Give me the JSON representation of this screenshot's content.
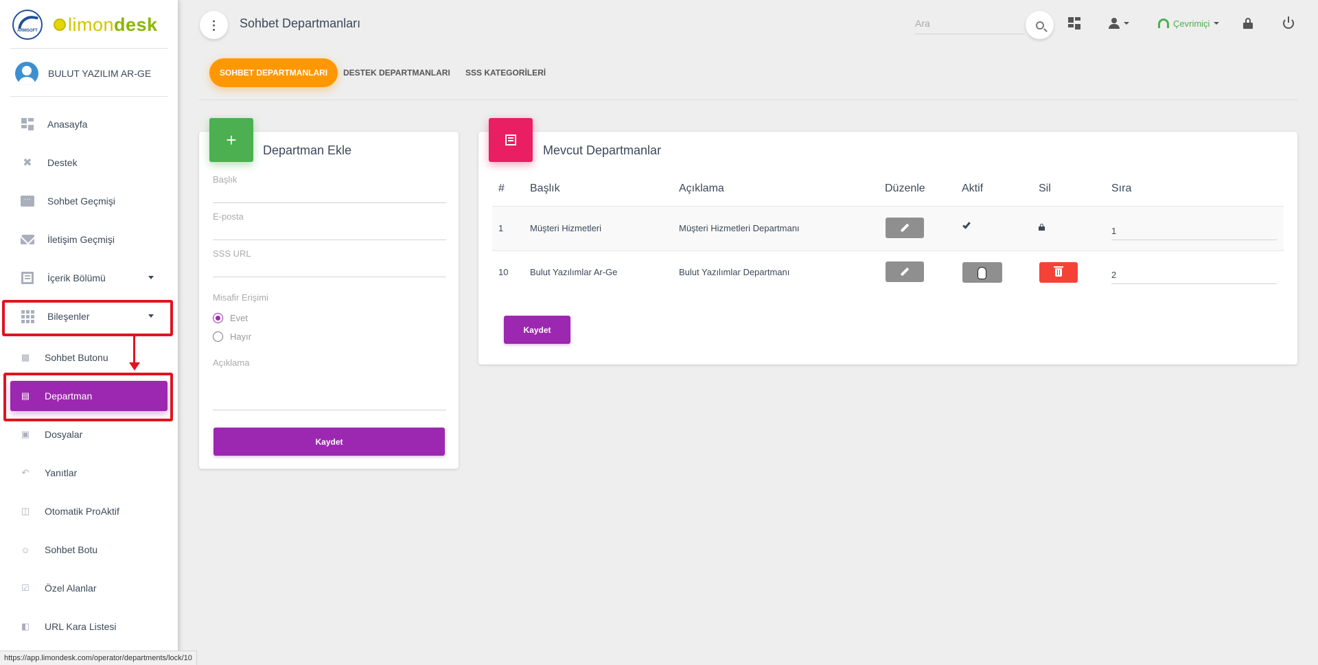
{
  "app": {
    "logo_primary": "limon",
    "logo_secondary": "desk",
    "emblem_text": "ARMSOFT"
  },
  "sidebar": {
    "user_name": "BULUT YAZILIM AR-GE",
    "items": [
      {
        "label": "Anasayfa",
        "icon": "dashboard-icon"
      },
      {
        "label": "Destek",
        "icon": "support-icon"
      },
      {
        "label": "Sohbet Geçmişi",
        "icon": "chat-history-icon"
      },
      {
        "label": "İletişim Geçmişi",
        "icon": "mail-icon"
      },
      {
        "label": "İçerik Bölümü",
        "icon": "content-icon"
      },
      {
        "label": "Bileşenler",
        "icon": "apps-grid-icon"
      }
    ],
    "sub_items": [
      {
        "label": "Sohbet Butonu",
        "icon": "widgets-icon"
      },
      {
        "label": "Departman",
        "icon": "list-icon"
      },
      {
        "label": "Dosyalar",
        "icon": "files-icon"
      },
      {
        "label": "Yanıtlar",
        "icon": "reply-icon"
      },
      {
        "label": "Otomatik ProAktif",
        "icon": "cast-icon"
      },
      {
        "label": "Sohbet Botu",
        "icon": "smiley-icon"
      },
      {
        "label": "Özel Alanlar",
        "icon": "check-box-icon"
      },
      {
        "label": "URL Kara Listesi",
        "icon": "traffic-icon"
      }
    ]
  },
  "header": {
    "title": "Sohbet Departmanları",
    "search_placeholder": "Ara",
    "status_label": "Çevrimiçi"
  },
  "tabs": [
    {
      "label": "SOHBET DEPARTMANLARI",
      "active": true
    },
    {
      "label": "DESTEK DEPARTMANLARI",
      "active": false
    },
    {
      "label": "SSS KATEGORİLERİ",
      "active": false
    }
  ],
  "add_form": {
    "title": "Departman Ekle",
    "fields": {
      "title_label": "Başlık",
      "email_label": "E-posta",
      "faq_url_label": "SSS URL",
      "description_label": "Açıklama"
    },
    "guest_access": {
      "label": "Misafir Erişimi",
      "options": [
        "Evet",
        "Hayır"
      ],
      "selected": "Evet"
    },
    "submit_label": "Kaydet"
  },
  "departments": {
    "title": "Mevcut Departmanlar",
    "columns": [
      "#",
      "Başlık",
      "Açıklama",
      "Düzenle",
      "Aktif",
      "Sil",
      "Sıra"
    ],
    "rows": [
      {
        "id": "1",
        "title": "Müşteri Hizmetleri",
        "description": "Müşteri Hizmetleri Departmanı",
        "active": true,
        "locked": true,
        "order": "1"
      },
      {
        "id": "10",
        "title": "Bulut Yazılımlar Ar-Ge",
        "description": "Bulut Yazılımlar Departmanı",
        "active": false,
        "locked": false,
        "order": "2"
      }
    ],
    "save_label": "Kaydet"
  },
  "statusbar": {
    "url": "https://app.limondesk.com/operator/departments/lock/10"
  },
  "colors": {
    "accent_purple": "#9c27b0",
    "tab_orange": "#ff9800",
    "add_green": "#4caf50",
    "list_pink": "#e91e63",
    "delete_red": "#f44336",
    "highlight_red": "#e0141e"
  }
}
